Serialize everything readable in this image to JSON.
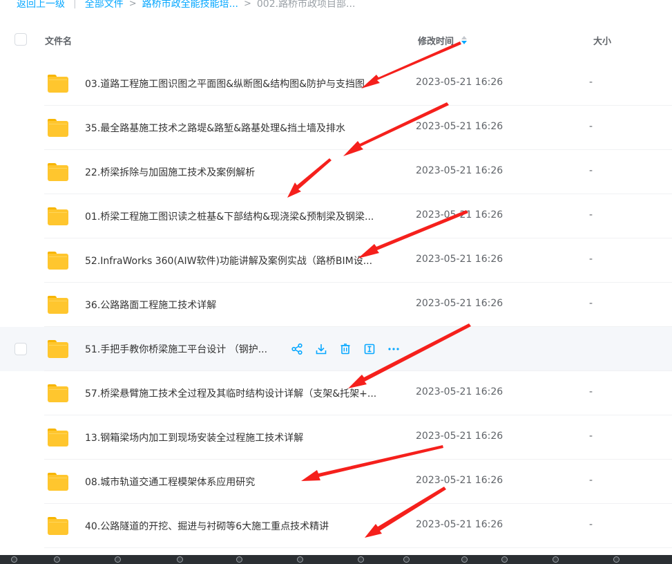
{
  "breadcrumb": {
    "back": "返回上一级",
    "all_files": "全部文件",
    "folder1": "路桥市政全能技能培...",
    "current": "002.路桥市政项目部..."
  },
  "header": {
    "name": "文件名",
    "modified": "修改时间",
    "size": "大小"
  },
  "files": [
    {
      "name": "03.道路工程施工图识图之平面图&纵断图&结构图&防护与支挡图",
      "time": "2023-05-21 16:26",
      "size": "-"
    },
    {
      "name": "35.最全路基施工技术之路堤&路堑&路基处理&挡土墙及排水",
      "time": "2023-05-21 16:26",
      "size": "-"
    },
    {
      "name": "22.桥梁拆除与加固施工技术及案例解析",
      "time": "2023-05-21 16:26",
      "size": "-"
    },
    {
      "name": "01.桥梁工程施工图识读之桩基&下部结构&现浇梁&预制梁及钢梁...",
      "time": "2023-05-21 16:26",
      "size": "-"
    },
    {
      "name": "52.InfraWorks 360(AIW软件)功能讲解及案例实战（路桥BIM设...",
      "time": "2023-05-21 16:26",
      "size": "-"
    },
    {
      "name": "36.公路路面工程施工技术详解",
      "time": "2023-05-21 16:26",
      "size": "-"
    },
    {
      "name": "51.手把手教你桥梁施工平台设计 （钢护...",
      "time": "",
      "size": ""
    },
    {
      "name": "57.桥梁悬臂施工技术全过程及其临时结构设计详解（支架&托架+...",
      "time": "2023-05-21 16:26",
      "size": "-"
    },
    {
      "name": "13.钢箱梁场内加工到现场安装全过程施工技术详解",
      "time": "2023-05-21 16:26",
      "size": "-"
    },
    {
      "name": "08.城市轨道交通工程模架体系应用研究",
      "time": "2023-05-21 16:26",
      "size": "-"
    },
    {
      "name": "40.公路隧道的开挖、掘进与衬砌等6大施工重点技术精讲",
      "time": "2023-05-21 16:26",
      "size": "-"
    }
  ],
  "row_actions": [
    "share-icon",
    "download-icon",
    "delete-icon",
    "rename-icon",
    "more-icon"
  ],
  "colors": {
    "accent": "#06a7ff",
    "folder": "#ffc62e",
    "arrow": "#f5201c",
    "hover_row": "#f5f7fa"
  }
}
